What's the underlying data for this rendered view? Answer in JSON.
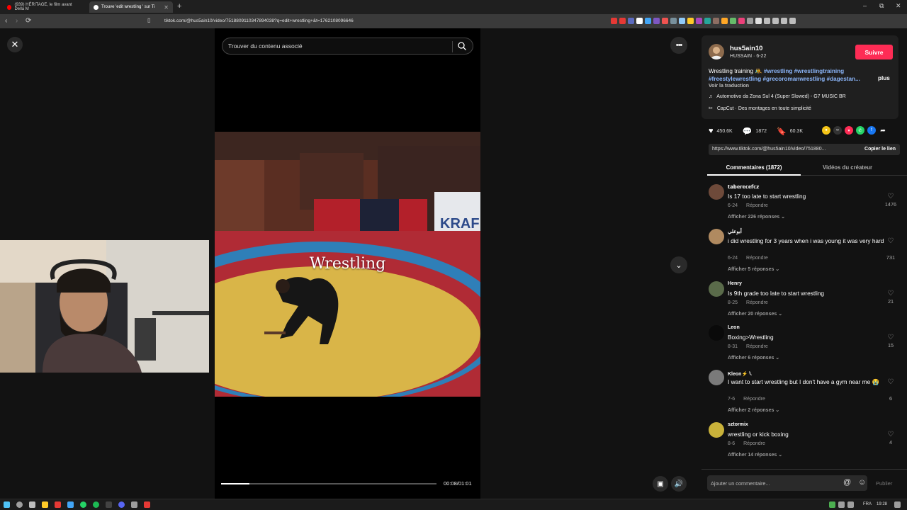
{
  "browser": {
    "tabs": [
      {
        "title": "(939) HÉRITAGE, le film avant Della M",
        "favicon_color": "#ff0000"
      },
      {
        "title": "Trouve 'edit wrestling ' sur Ti",
        "favicon_color": "#ffffff"
      }
    ],
    "new_tab_label": "+",
    "url": "tiktok.com/@hus5ain10/video/7518809110347894038?q=edit+wrestling+&t=1762108096646",
    "window_controls": [
      "–",
      "⧉",
      "✕"
    ]
  },
  "page": {
    "close_icon": "✕",
    "more_icon": "•••",
    "next_icon": "⌄",
    "search": {
      "placeholder": "Trouver du contenu associé",
      "icon": "search-icon"
    },
    "video": {
      "caption": "Wrestling",
      "progress": 0.13,
      "time": "00:08/01:01"
    }
  },
  "panel": {
    "author": {
      "handle": "hus5ain10",
      "subtitle": "HUSSAIN · 6-22",
      "follow_label": "Suivre"
    },
    "description": {
      "text": "Wrestling training 🤼 ",
      "tags": "#wrestling #wrestlingtraining #freestylewrestling #grecoromanwrestling #dagestan...",
      "more_label": "plus",
      "translate_label": "Voir la traduction"
    },
    "music": "Automotivo da Zona Sul 4 (Super Slowed) - G7 MUSIC BR",
    "capcut": "CapCut · Des montages en toute simplicité",
    "stats": {
      "likes": "450.6K",
      "comments": "1872",
      "saves": "60.3K"
    },
    "share_colors": [
      "#f5c518",
      "#333333",
      "#fe2c55",
      "#25d366",
      "#1877f2"
    ],
    "link": {
      "url": "https://www.tiktok.com/@hus5ain10/video/751880...",
      "copy_label": "Copier le lien"
    },
    "tabs": {
      "comments": "Commentaires (1872)",
      "creator": "Vidéos du créateur"
    },
    "comments": [
      {
        "user": "𝕥𝕒𝕓𝕖𝕣𝕖𝕔𝕖𝕗𝕔𝕫",
        "text": "Is 17 too late to start wrestling",
        "date": "6-24",
        "reply": "Répondre",
        "more": "Afficher 226 réponses ⌄",
        "likes": "1476",
        "avatar_color": "#6e4a3a"
      },
      {
        "user": "أبوعلي",
        "text": "i did wrestling for 3 years when i was young it was very hard",
        "date": "6-24",
        "reply": "Répondre",
        "more": "Afficher 5 réponses ⌄",
        "likes": "731",
        "avatar_color": "#b08a60"
      },
      {
        "user": "Henry",
        "text": "Is 9th grade too late to start wrestling",
        "date": "8-25",
        "reply": "Répondre",
        "more": "Afficher 20 réponses ⌄",
        "likes": "21",
        "avatar_color": "#5a6b4a"
      },
      {
        "user": "Leon",
        "text": "Boxing>Wrestling",
        "date": "8-31",
        "reply": "Répondre",
        "more": "Afficher 6 réponses ⌄",
        "likes": "15",
        "avatar_color": "#0a0a0a"
      },
      {
        "user": "Kleon⚡ 𓆩",
        "text": "I want to start wrestling but I don't have a gym near me 😭",
        "date": "7-6",
        "reply": "Répondre",
        "more": "Afficher 2 réponses ⌄",
        "likes": "6",
        "avatar_color": "#7a7a7a"
      },
      {
        "user": "sztormix",
        "text": "wrestling or kick boxing",
        "date": "8-6",
        "reply": "Répondre",
        "more": "Afficher 14 réponses ⌄",
        "likes": "4",
        "avatar_color": "#c9b23a"
      }
    ],
    "composer": {
      "placeholder": "Ajouter un commentaire...",
      "publish_label": "Publier"
    }
  },
  "taskbar": {
    "lang": "FRA",
    "time": "19:28"
  }
}
